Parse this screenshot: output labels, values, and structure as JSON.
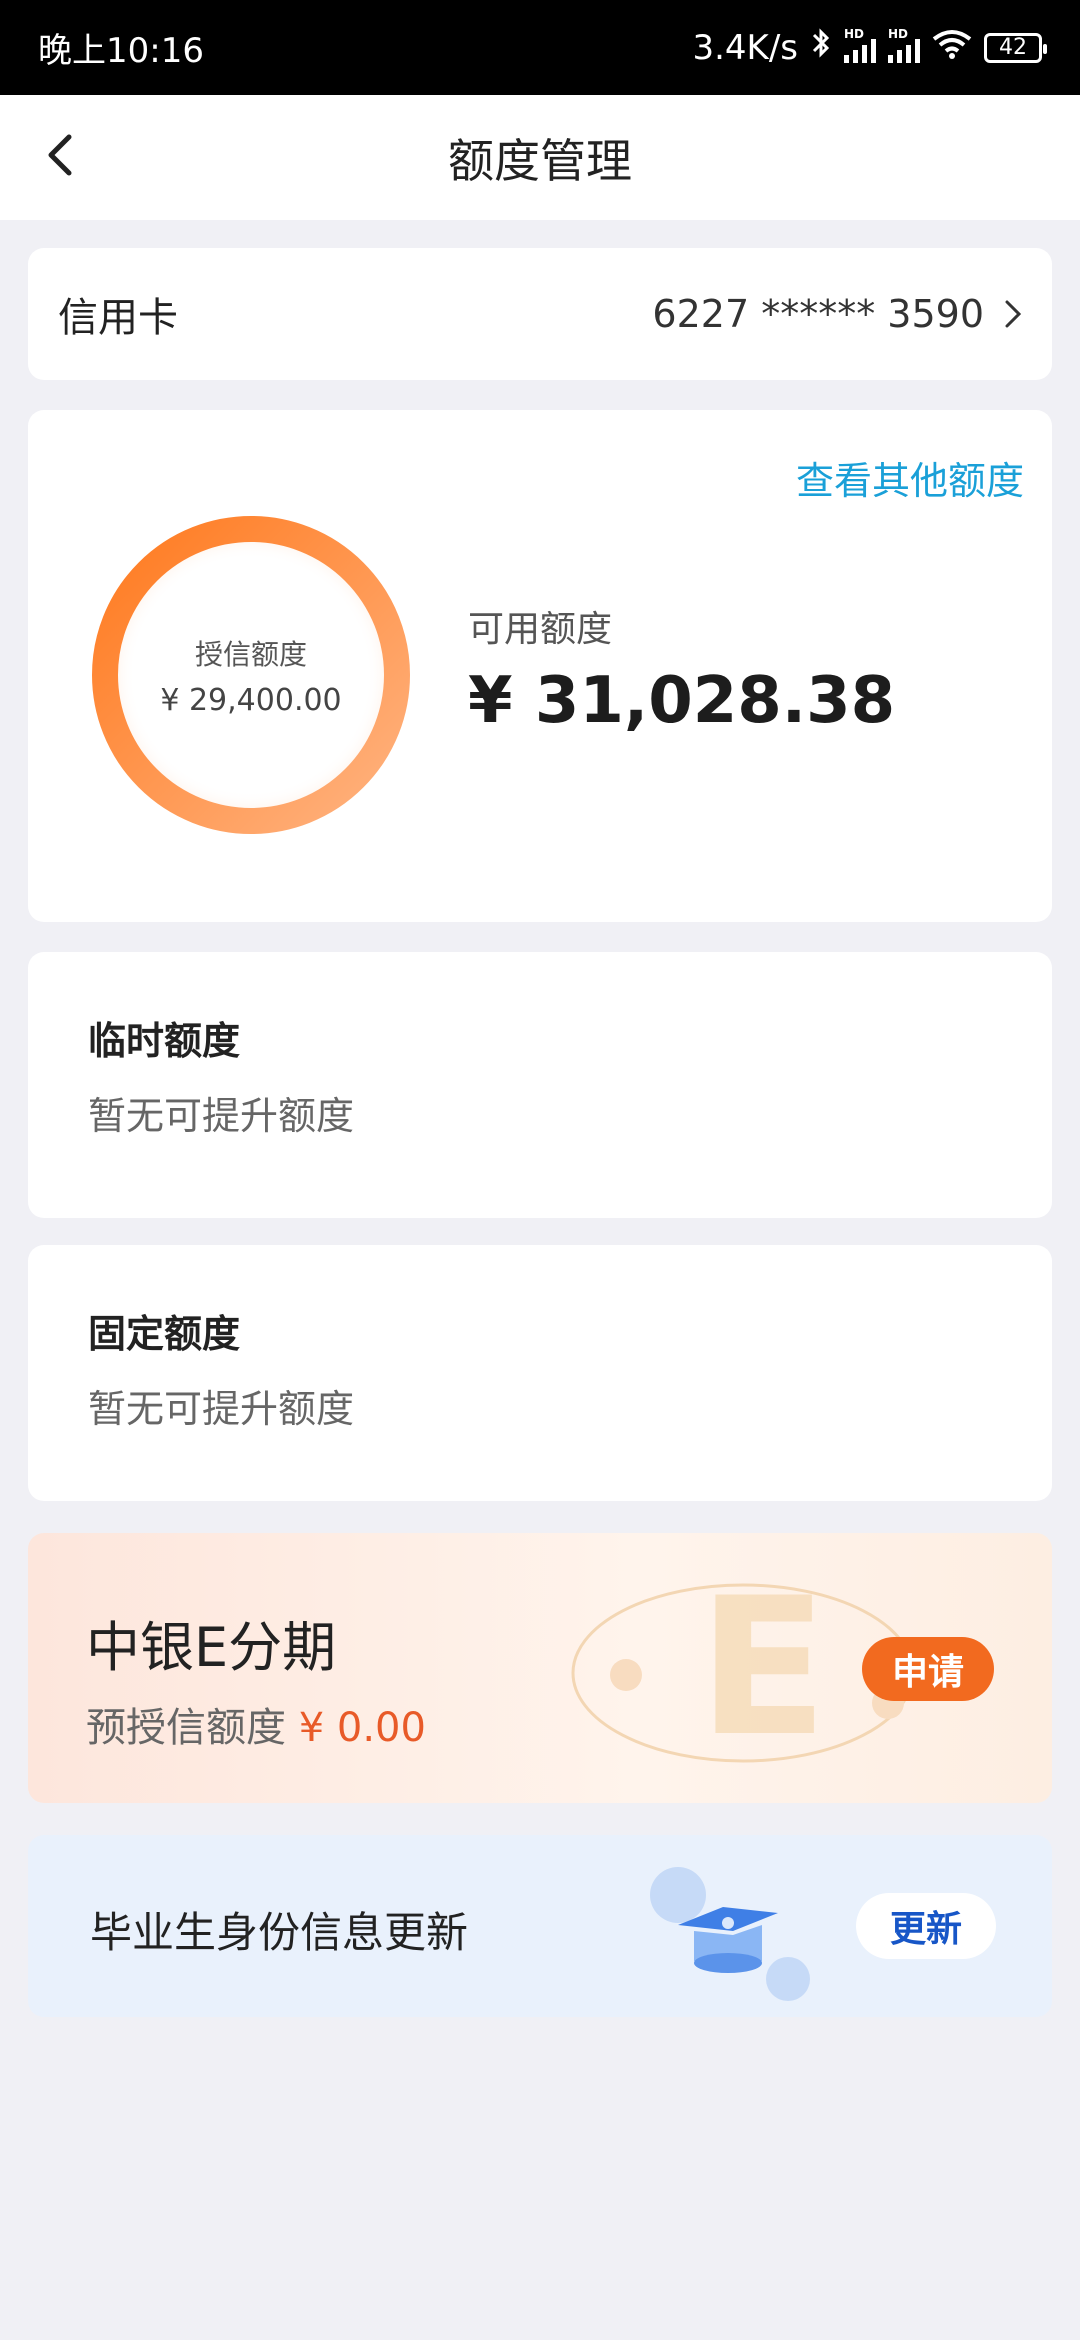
{
  "status_bar": {
    "time": "晚上10:16",
    "network_speed": "3.4K/s",
    "signal_hd_label": "HD",
    "battery": "42"
  },
  "header": {
    "title": "额度管理"
  },
  "card_selector": {
    "label": "信用卡",
    "card_number": "6227 ****** 3590"
  },
  "credit": {
    "view_other": "查看其他额度",
    "granted_label": "授信额度",
    "granted_value": "¥ 29,400.00",
    "available_label": "可用额度",
    "available_value": "¥ 31,028.38"
  },
  "temporary": {
    "title": "临时额度",
    "subtitle": "暂无可提升额度"
  },
  "fixed": {
    "title": "固定额度",
    "subtitle": "暂无可提升额度"
  },
  "installment": {
    "title": "中银E分期",
    "sub_label": "预授信额度",
    "amount": "¥ 0.00",
    "button": "申请",
    "deco_letter": "E"
  },
  "graduate": {
    "title": "毕业生身份信息更新",
    "button": "更新"
  },
  "colors": {
    "accent_orange": "#f26a1f",
    "link_blue": "#1aa0d8",
    "button_blue": "#1756c7"
  }
}
